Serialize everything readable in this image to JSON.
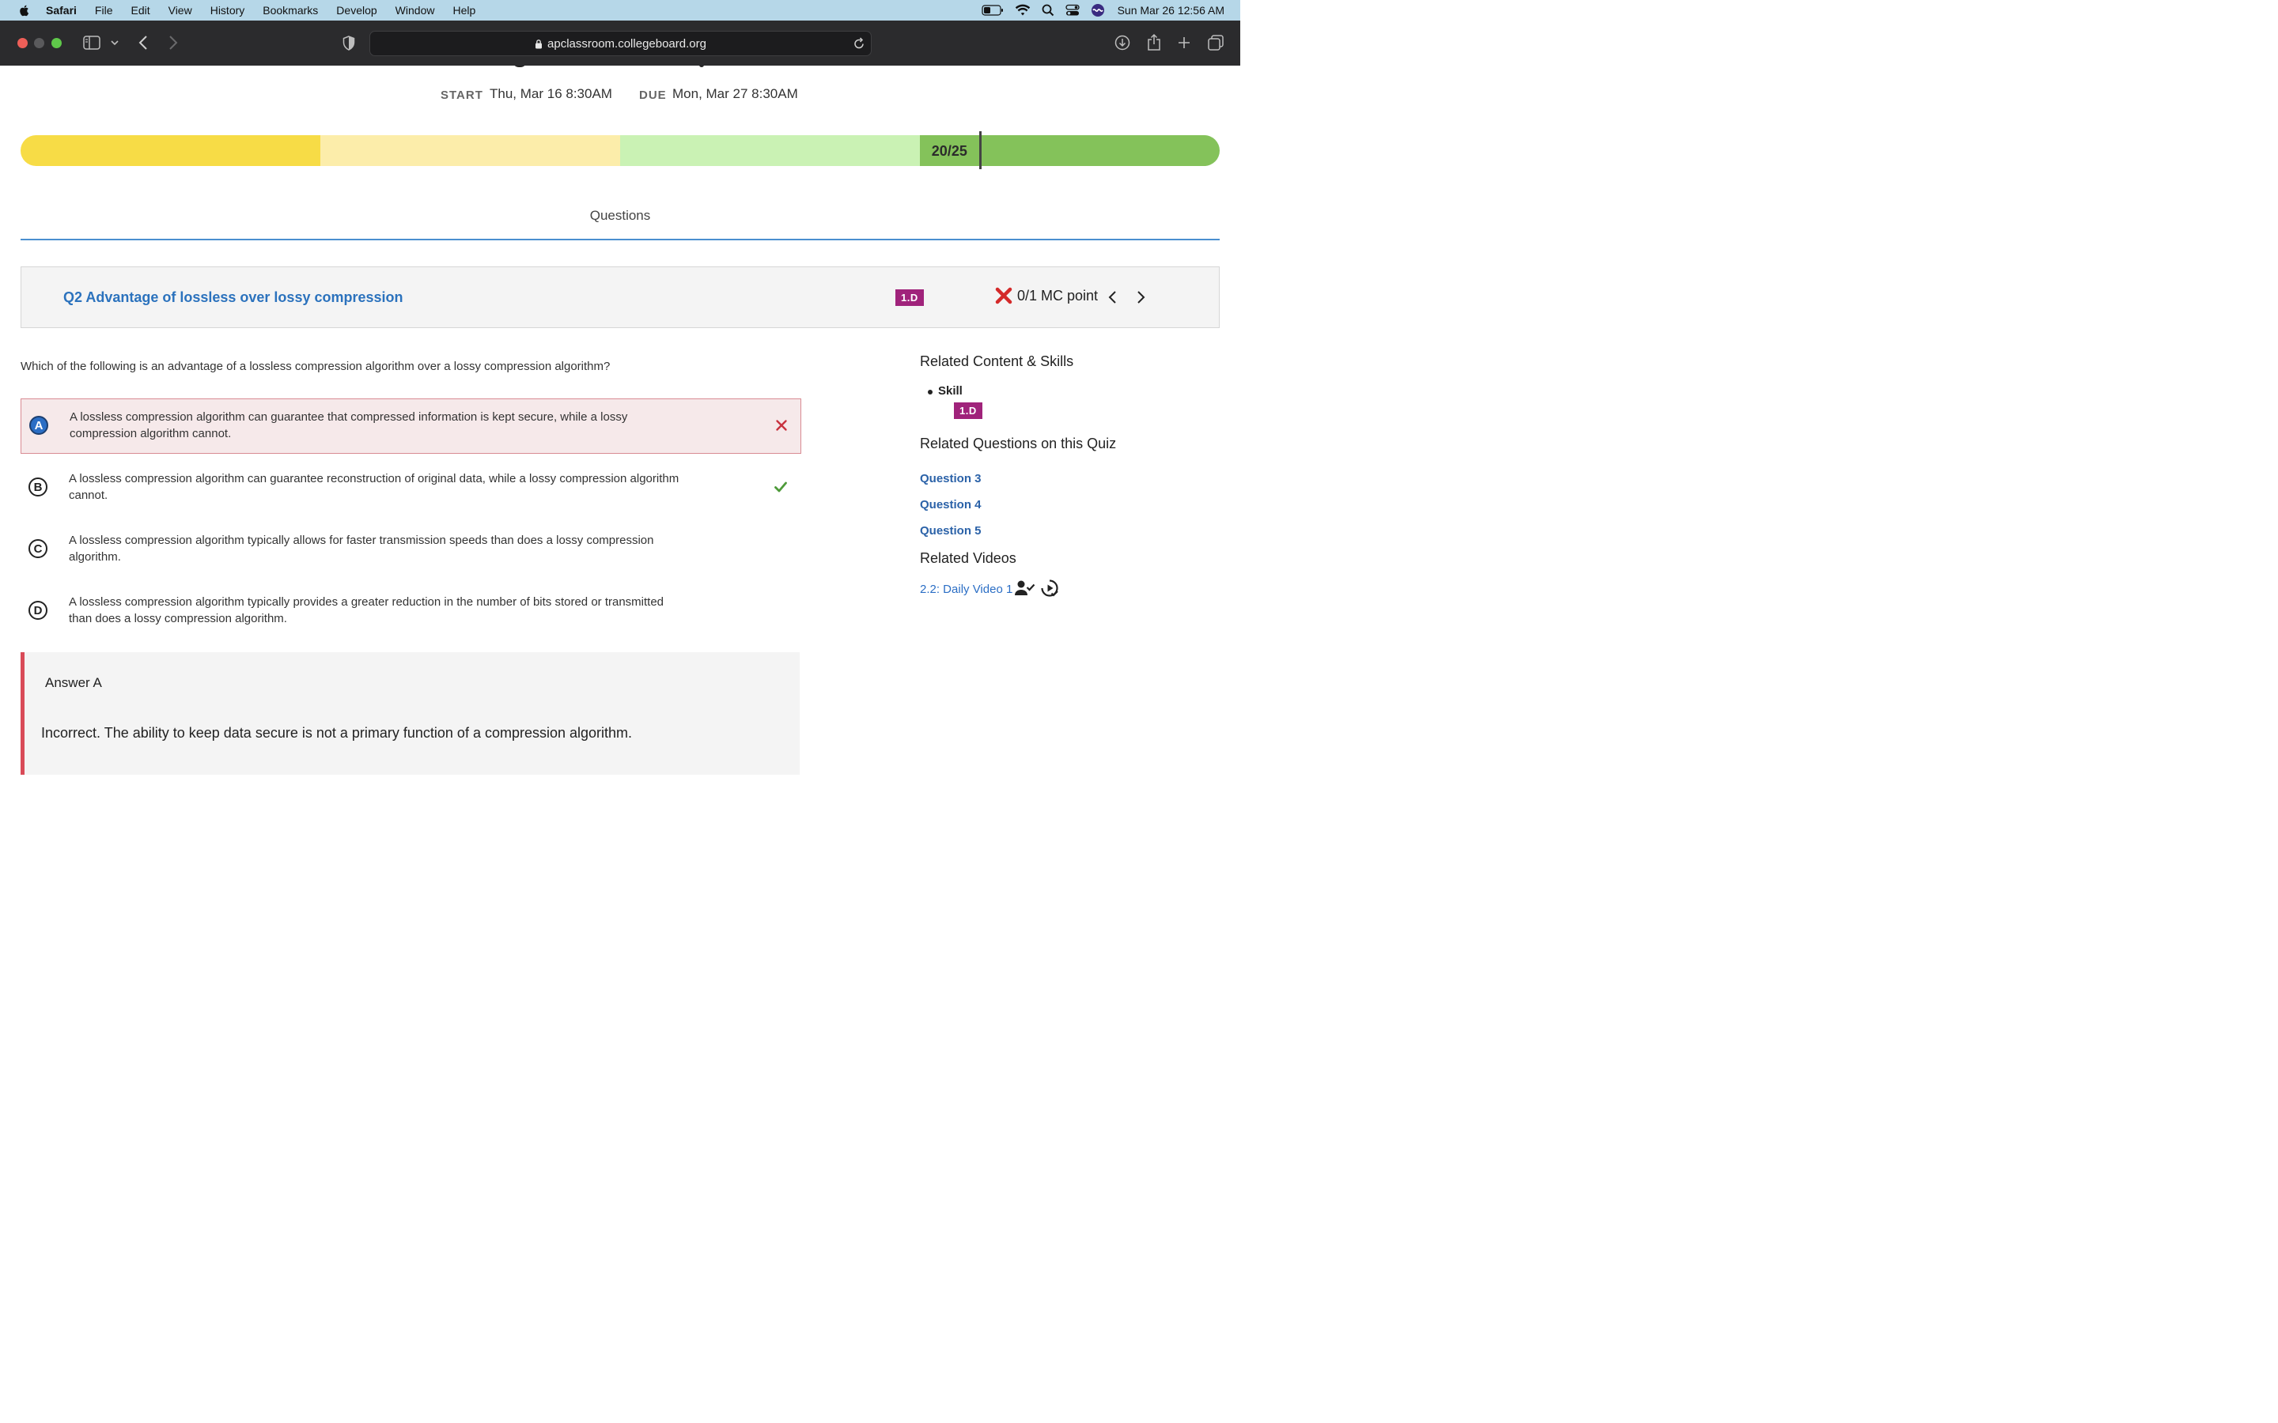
{
  "menubar": {
    "items": [
      "Safari",
      "File",
      "Edit",
      "View",
      "History",
      "Bookmarks",
      "Develop",
      "Window",
      "Help"
    ],
    "clock": "Sun Mar 26  12:56 AM"
  },
  "browser": {
    "url": "apclassroom.collegeboard.org"
  },
  "assignment": {
    "start_label": "START",
    "start_value": "Thu, Mar 16 8:30AM",
    "due_label": "DUE",
    "due_value": "Mon, Mar 27 8:30AM",
    "score_text": "20/25",
    "score_fraction": 0.8,
    "bar_colors": [
      "#f7dc46",
      "#fcedaa",
      "#caf2b4",
      "#84c25a"
    ]
  },
  "tabs": {
    "questions": "Questions"
  },
  "question": {
    "title": "Q2 Advantage of lossless over lossy compression",
    "skill_badge": "1.D",
    "points": "0/1 MC point",
    "text": "Which of the following is an advantage of a lossless compression algorithm over a lossy compression algorithm?",
    "options": [
      {
        "letter": "A",
        "text": "A lossless compression algorithm can guarantee that compressed information is kept secure, while a lossy compression algorithm cannot."
      },
      {
        "letter": "B",
        "text": "A lossless compression algorithm can guarantee reconstruction of original data, while a lossy compression algorithm cannot."
      },
      {
        "letter": "C",
        "text": "A lossless compression algorithm typically allows for faster transmission speeds than does a lossy compression algorithm."
      },
      {
        "letter": "D",
        "text": "A lossless compression algorithm typically provides a greater reduction in the number of bits stored or transmitted than does a lossy compression algorithm."
      }
    ]
  },
  "answer": {
    "title": "Answer A",
    "explanation": "Incorrect. The ability to keep data secure is not a primary function of a compression algorithm."
  },
  "sidebar": {
    "related_content_heading": "Related Content & Skills",
    "skill_label": "Skill",
    "skill_badge": "1.D",
    "related_questions_heading": "Related Questions on this Quiz",
    "related_questions": [
      "Question 3",
      "Question 4",
      "Question 5"
    ],
    "related_videos_heading": "Related Videos",
    "video_link": "2.2: Daily Video 1"
  },
  "colors": {
    "accent_blue": "#2b72bd",
    "badge": "#a0237b",
    "wrong": "#d94b58",
    "correct": "#4e9a3a"
  }
}
